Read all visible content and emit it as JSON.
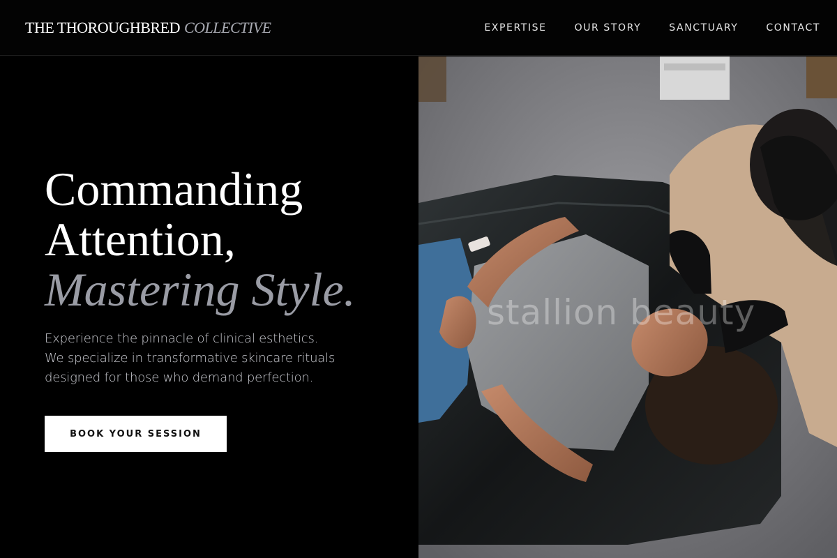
{
  "brand": {
    "name": "THE THOROUGHBRED",
    "accent": "COLLECTIVE"
  },
  "nav": {
    "items": [
      {
        "label": "EXPERTISE"
      },
      {
        "label": "OUR STORY"
      },
      {
        "label": "SANCTUARY"
      },
      {
        "label": "CONTACT"
      }
    ]
  },
  "hero": {
    "headline_line1": "Commanding",
    "headline_line2": "Attention,",
    "headline_accent": "Mastering Style.",
    "lead_lines": [
      "Experience the pinnacle of clinical esthetics.",
      "We specialize in transformative skincare rituals",
      "designed for those who demand perfection."
    ],
    "cta_label": "BOOK YOUR SESSION"
  },
  "image": {
    "watermark": "stallion beauty",
    "subject": "overhead photo of an esthetician performing a facial treatment on a client lying on a black leather bed"
  },
  "colors": {
    "background": "#000000",
    "text": "#ffffff",
    "accent_text": "#9a9ca5",
    "body_text": "#c9cad0",
    "button_bg": "#ffffff",
    "button_text": "#111111"
  }
}
